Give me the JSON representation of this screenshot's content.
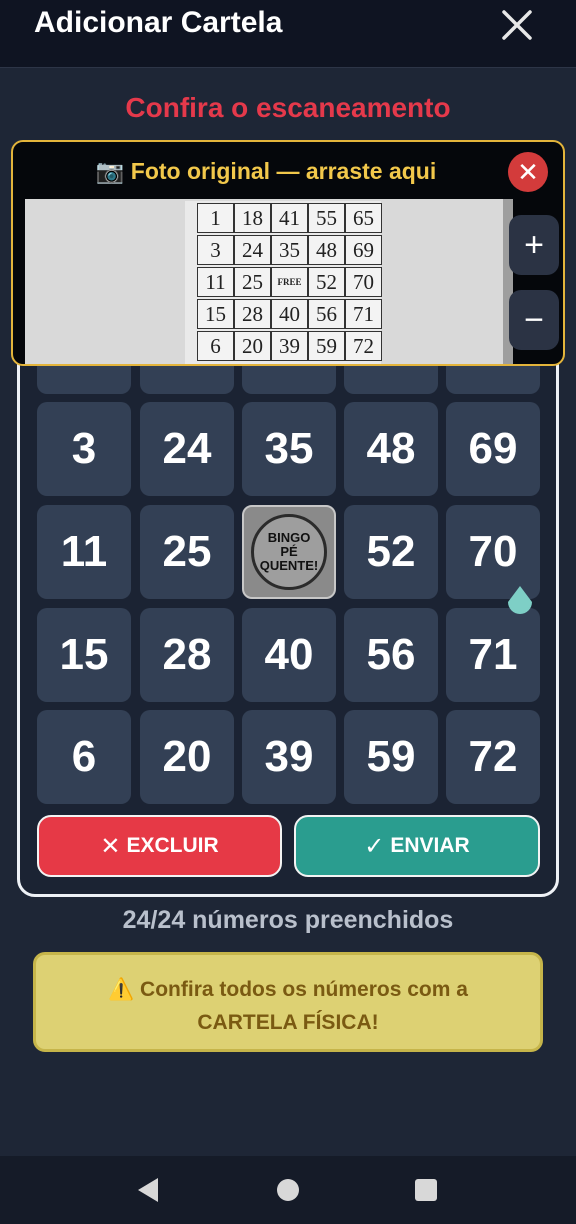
{
  "header": {
    "title": "Adicionar Cartela",
    "close_icon": "close-icon"
  },
  "subtitle": "Confira o escaneamento",
  "photo": {
    "title": "📷 Foto original — arraste aqui",
    "close_symbol": "✕",
    "zoom_in_symbol": "+",
    "zoom_out_symbol": "−",
    "scanned_card": {
      "rows": [
        [
          "1",
          "18",
          "41",
          "55",
          "65"
        ],
        [
          "3",
          "24",
          "35",
          "48",
          "69"
        ],
        [
          "11",
          "25",
          "FREE",
          "52",
          "70"
        ],
        [
          "15",
          "28",
          "40",
          "56",
          "71"
        ],
        [
          "6",
          "20",
          "39",
          "59",
          "72"
        ]
      ]
    }
  },
  "card": {
    "rows": [
      [
        "3",
        "24",
        "35",
        "48",
        "69"
      ],
      [
        "11",
        "25",
        "",
        "52",
        "70"
      ],
      [
        "15",
        "28",
        "40",
        "56",
        "71"
      ],
      [
        "6",
        "20",
        "39",
        "59",
        "72"
      ]
    ],
    "free_logo": {
      "line1": "BINGO",
      "line2": "PÉ QUENTE!"
    }
  },
  "buttons": {
    "delete_icon": "✕",
    "delete_label": "EXCLUIR",
    "send_icon": "✓",
    "send_label": "ENVIAR"
  },
  "status": {
    "count": "24/24 números preenchidos"
  },
  "warning": {
    "line1": "⚠️ Confira todos os números com a",
    "line2": "CARTELA FÍSICA!"
  },
  "colors": {
    "accent_red": "#e63946",
    "accent_teal": "#2a9d8f",
    "warning_yellow": "#ddd173",
    "panel_border": "#e3b43b"
  }
}
